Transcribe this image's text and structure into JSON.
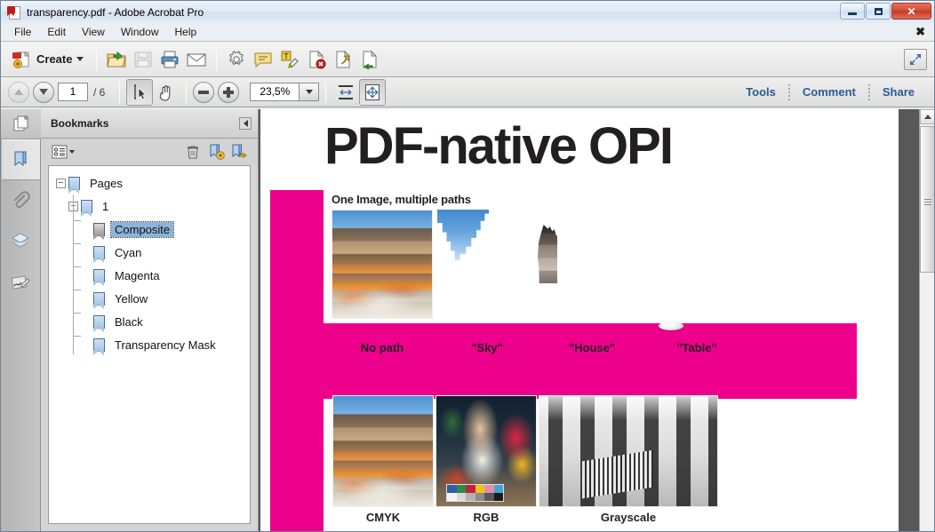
{
  "window": {
    "title": "transparency.pdf - Adobe Acrobat Pro",
    "app_icon": "pdf-document-icon",
    "minimize_label": "Minimize",
    "maximize_label": "Maximize",
    "close_label": "✕"
  },
  "menubar": {
    "items": [
      "File",
      "Edit",
      "View",
      "Window",
      "Help"
    ],
    "close_document_glyph": "✖"
  },
  "toolbar_main": {
    "create_label": "Create",
    "buttons": [
      {
        "name": "create-pdf-icon",
        "title": "Create"
      },
      {
        "name": "open-file-icon",
        "title": "Open"
      },
      {
        "name": "save-icon",
        "title": "Save"
      },
      {
        "name": "print-icon",
        "title": "Print"
      },
      {
        "name": "email-icon",
        "title": "Email"
      },
      {
        "name": "gear-icon",
        "title": "Settings"
      },
      {
        "name": "comment-bubble-icon",
        "title": "Add Sticky Note"
      },
      {
        "name": "highlight-text-icon",
        "title": "Highlight Text"
      },
      {
        "name": "page-delete-icon",
        "title": "Delete Pages"
      },
      {
        "name": "page-extract-icon",
        "title": "Extract Pages"
      },
      {
        "name": "page-replace-icon",
        "title": "Replace Pages"
      }
    ],
    "expand_button": "expand-icon"
  },
  "toolbar_sub": {
    "page_value": "1",
    "page_total": "/ 6",
    "zoom_value": "23,5%",
    "select_tool": "select-text-icon",
    "hand_tool": "hand-icon",
    "zoom_out": "zoom-out-icon",
    "zoom_in": "zoom-in-icon",
    "fit_width": "fit-width-icon",
    "fit_page": "fit-page-icon",
    "right_links": [
      "Tools",
      "Comment",
      "Share"
    ]
  },
  "nav_rail": {
    "items": [
      {
        "name": "page-thumbnails-icon",
        "label": "Page Thumbnails",
        "active": false
      },
      {
        "name": "bookmarks-icon",
        "label": "Bookmarks",
        "active": true
      },
      {
        "name": "attachments-icon",
        "label": "Attachments",
        "active": false
      },
      {
        "name": "layers-icon",
        "label": "Layers",
        "active": false
      },
      {
        "name": "signatures-icon",
        "label": "Signatures",
        "active": false
      }
    ]
  },
  "bookmarks_panel": {
    "title": "Bookmarks",
    "collapse_icon": "collapse-panel-icon",
    "options_icon": "options-menu-icon",
    "delete_icon": "trash-icon",
    "new_bookmark_icon": "new-bookmark-icon",
    "next_bookmark_icon": "next-bookmark-icon",
    "tree": [
      {
        "label": "Pages",
        "depth": 0,
        "expander": "−",
        "selected": false,
        "icon": "bookmark-icon"
      },
      {
        "label": "1",
        "depth": 1,
        "expander": "−",
        "selected": false,
        "icon": "bookmark-icon"
      },
      {
        "label": "Composite",
        "depth": 2,
        "expander": "",
        "selected": true,
        "icon": "bookmark-icon-grey"
      },
      {
        "label": "Cyan",
        "depth": 2,
        "expander": "",
        "selected": false,
        "icon": "bookmark-icon"
      },
      {
        "label": "Magenta",
        "depth": 2,
        "expander": "",
        "selected": false,
        "icon": "bookmark-icon"
      },
      {
        "label": "Yellow",
        "depth": 2,
        "expander": "",
        "selected": false,
        "icon": "bookmark-icon"
      },
      {
        "label": "Black",
        "depth": 2,
        "expander": "",
        "selected": false,
        "icon": "bookmark-icon"
      },
      {
        "label": "Transparency Mask",
        "depth": 2,
        "expander": "",
        "selected": false,
        "icon": "bookmark-icon"
      }
    ]
  },
  "document": {
    "title": "PDF-native OPI",
    "section_heading": "One Image, multiple paths",
    "accent_color": "#ec008c",
    "path_captions": [
      "No path",
      "\"Sky\"",
      "\"House\"",
      "\"Table\""
    ],
    "colorspace_captions": [
      "CMYK",
      "RGB",
      "Grayscale"
    ],
    "images": [
      {
        "name": "street-scene-full",
        "caption": "No path"
      },
      {
        "name": "sky-clipped-fragment",
        "caption": "\"Sky\""
      },
      {
        "name": "house-clipped-fragment",
        "caption": "\"House\""
      },
      {
        "name": "table-clipped-fragment",
        "caption": "\"Table\""
      },
      {
        "name": "street-scene-cmyk",
        "caption": "CMYK"
      },
      {
        "name": "woman-flowers-rgb",
        "caption": "RGB"
      },
      {
        "name": "band-photo-grayscale",
        "caption": "Grayscale"
      }
    ],
    "colorbar_swatches": [
      "#2a5fa8",
      "#2f8a4d",
      "#c2233a",
      "#f0c419",
      "#e08fb0",
      "#3fa9d4",
      "#f2f2f2",
      "#d9d9d9",
      "#b3b3b3",
      "#8c8c8c",
      "#595959",
      "#1a1a1a"
    ]
  },
  "scrollbar": {
    "up_arrow": "scroll-up-icon",
    "thumb": "scroll-thumb"
  }
}
